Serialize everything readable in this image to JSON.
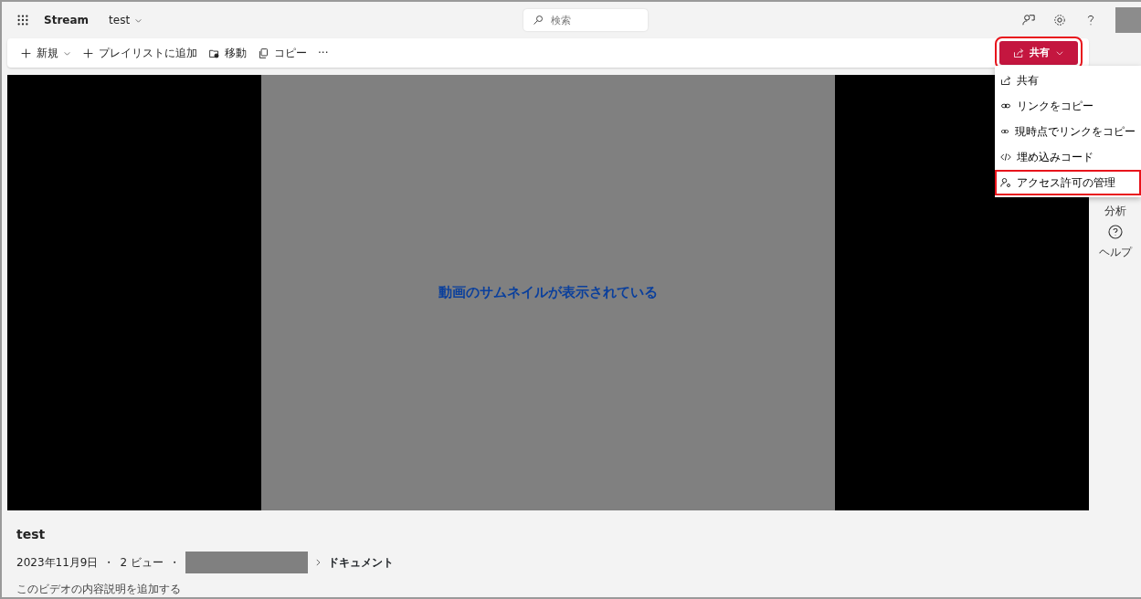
{
  "app_bar": {
    "app_name": "Stream",
    "breadcrumb": "test",
    "search": {
      "placeholder": "検索"
    }
  },
  "toolbar": [
    {
      "label": "新規",
      "kind": "plus",
      "dropdown": true
    },
    {
      "label": "プレイリストに追加",
      "kind": "plus",
      "dropdown": false
    },
    {
      "label": "移動",
      "kind": "move",
      "dropdown": false
    },
    {
      "label": "コピー",
      "kind": "copy",
      "dropdown": false
    },
    {
      "label": "···",
      "kind": "more",
      "dropdown": false
    }
  ],
  "share_button": {
    "label": "共有",
    "highlighted": true
  },
  "share_menu": [
    {
      "label": "共有",
      "kind": "share",
      "highlighted": false
    },
    {
      "label": "リンクをコピー",
      "kind": "link",
      "highlighted": false
    },
    {
      "label": "現時点でリンクをコピー",
      "kind": "link",
      "highlighted": false
    },
    {
      "label": "埋め込みコード",
      "kind": "code",
      "highlighted": false
    },
    {
      "label": "アクセス許可の管理",
      "kind": "person",
      "highlighted": true
    }
  ],
  "video": {
    "caption": "動画のサムネイルが表示されている"
  },
  "side_panel": [
    {
      "label": "分析",
      "kind": "analytics"
    },
    {
      "label": "ヘルプ",
      "kind": "help"
    }
  ],
  "details": {
    "title": "test",
    "meta": [
      "2023年11月9日",
      "・",
      "2 ビュー",
      "・"
    ],
    "location": "ドキュメント",
    "description_prompt": "このビデオの内容説明を追加する"
  }
}
